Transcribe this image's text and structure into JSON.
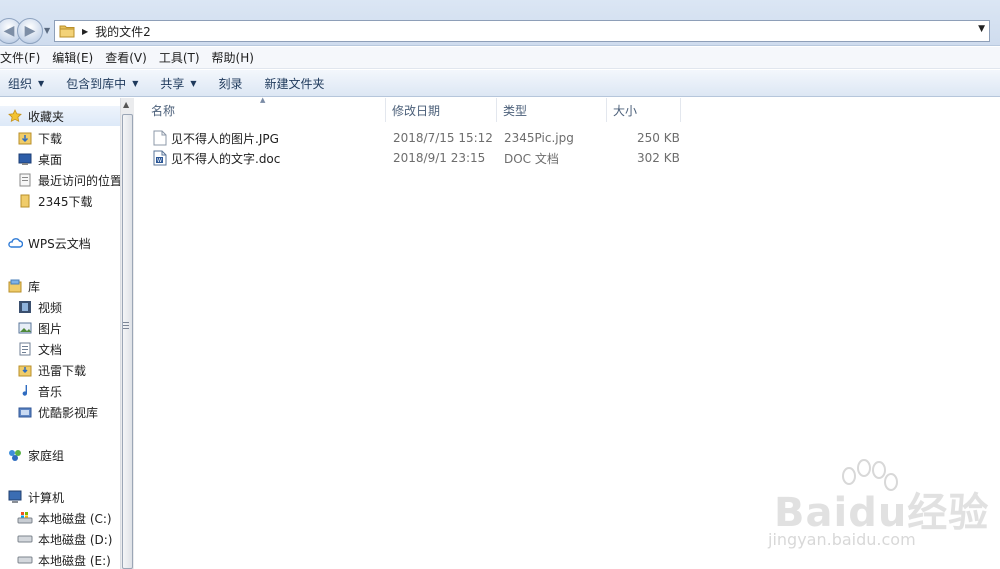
{
  "addressbar": {
    "path": "我的文件2"
  },
  "menubar": [
    {
      "label": "文件(F)"
    },
    {
      "label": "编辑(E)"
    },
    {
      "label": "查看(V)"
    },
    {
      "label": "工具(T)"
    },
    {
      "label": "帮助(H)"
    }
  ],
  "toolbar": {
    "organize": "组织",
    "include_library": "包含到库中",
    "share": "共享",
    "burn": "刻录",
    "new_folder": "新建文件夹"
  },
  "sidebar": {
    "favorites": "收藏夹",
    "downloads": "下载",
    "desktop": "桌面",
    "recent": "最近访问的位置",
    "dl2345": "2345下载",
    "wps": "WPS云文档",
    "libraries": "库",
    "videos": "视频",
    "pictures": "图片",
    "documents": "文档",
    "xunlei": "迅雷下载",
    "music": "音乐",
    "youku": "优酷影视库",
    "homegroup": "家庭组",
    "computer": "计算机",
    "drive_c": "本地磁盘 (C:)",
    "drive_d": "本地磁盘 (D:)",
    "drive_e": "本地磁盘 (E:)"
  },
  "columns": {
    "name": "名称",
    "date": "修改日期",
    "type": "类型",
    "size": "大小"
  },
  "files": [
    {
      "name": "见不得人的图片.JPG",
      "date": "2018/7/15 15:12",
      "type": "2345Pic.jpg",
      "size": "250 KB"
    },
    {
      "name": "见不得人的文字.doc",
      "date": "2018/9/1 23:15",
      "type": "DOC 文档",
      "size": "302 KB"
    }
  ],
  "watermark": {
    "brand": "Baidu经验",
    "url": "jingyan.baidu.com"
  }
}
